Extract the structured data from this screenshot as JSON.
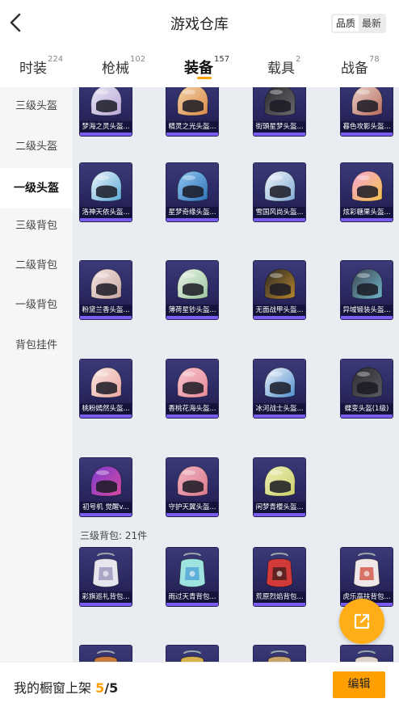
{
  "header": {
    "title": "游戏仓库",
    "sort_options": [
      "品质",
      "最新"
    ],
    "active_sort": "品质"
  },
  "tabs": [
    {
      "label": "时装",
      "count": "224"
    },
    {
      "label": "枪械",
      "count": "102"
    },
    {
      "label": "装备",
      "count": "157"
    },
    {
      "label": "载具",
      "count": "2"
    },
    {
      "label": "战备",
      "count": "78"
    }
  ],
  "active_tab": "装备",
  "sidebar": {
    "items": [
      {
        "label": "三级头盔"
      },
      {
        "label": "二级头盔"
      },
      {
        "label": "一级头盔"
      },
      {
        "label": "三级背包"
      },
      {
        "label": "二级背包"
      },
      {
        "label": "一级背包"
      },
      {
        "label": "背包挂件"
      }
    ],
    "active": "一级头盔"
  },
  "items": [
    {
      "name": "梦海之灵头盔...",
      "kind": "helmet",
      "colors": [
        "#e8e4f2",
        "#b9a9d9"
      ]
    },
    {
      "name": "精灵之光头盔...",
      "kind": "helmet",
      "colors": [
        "#f2d3a8",
        "#d98a4a"
      ]
    },
    {
      "name": "街頭星梦头盔...",
      "kind": "helmet",
      "colors": [
        "#2a2a2e",
        "#6a6a70"
      ]
    },
    {
      "name": "暮色攻影头盔...",
      "kind": "helmet",
      "colors": [
        "#e9d3cc",
        "#b86a5a"
      ]
    },
    {
      "name": "洛神天依头盔...",
      "kind": "helmet",
      "colors": [
        "#eef4fb",
        "#5aa9d6"
      ]
    },
    {
      "name": "星梦奇缘头盔...",
      "kind": "helmet",
      "colors": [
        "#8fc8f0",
        "#2f6fb8"
      ]
    },
    {
      "name": "雪国风尚头盔...",
      "kind": "helmet",
      "colors": [
        "#f2f6fa",
        "#7fa9d6"
      ]
    },
    {
      "name": "炫彩糖果头盔...",
      "kind": "helmet",
      "colors": [
        "#f7a6d6",
        "#f3c14a"
      ]
    },
    {
      "name": "粉黛兰香头盔...",
      "kind": "helmet",
      "colors": [
        "#f3e3e0",
        "#c9a7a2"
      ]
    },
    {
      "name": "薄荷星钞头盔...",
      "kind": "helmet",
      "colors": [
        "#e8f3e6",
        "#9cc7a0"
      ]
    },
    {
      "name": "无面战甲头盔...",
      "kind": "helmet",
      "colors": [
        "#2a2824",
        "#b8862e"
      ]
    },
    {
      "name": "异域锻装头盔...",
      "kind": "helmet",
      "colors": [
        "#3d4450",
        "#6fb6c9"
      ]
    },
    {
      "name": "桃粉嫣然头盔...",
      "kind": "helmet",
      "colors": [
        "#fbe7e2",
        "#e9a7a0"
      ]
    },
    {
      "name": "香桃花海头盔...",
      "kind": "helmet",
      "colors": [
        "#f6c4cc",
        "#e88a9a"
      ]
    },
    {
      "name": "冰河战士头盔...",
      "kind": "helmet",
      "colors": [
        "#eef3f8",
        "#4f8fd0"
      ]
    },
    {
      "name": "蝶变头盔(1级)",
      "kind": "helmet",
      "colors": [
        "#2c2c30",
        "#5a5a62"
      ]
    },
    {
      "name": "初号机 觉醒v...",
      "kind": "helmet",
      "colors": [
        "#7a3bd0",
        "#d64aa0"
      ]
    },
    {
      "name": "守护天翼头盔...",
      "kind": "helmet",
      "colors": [
        "#f2b3c0",
        "#d97a8e"
      ]
    },
    {
      "name": "闲梦青樱头盔...",
      "kind": "helmet",
      "colors": [
        "#eef0b8",
        "#c9cf6a"
      ]
    },
    {
      "name": "彩旗巡礼背包...",
      "kind": "backpack",
      "colors": [
        "#e6e6ef",
        "#9a8fb8"
      ]
    },
    {
      "name": "雨过天青背包...",
      "kind": "backpack",
      "colors": [
        "#9ee3e0",
        "#4a9fd6"
      ]
    },
    {
      "name": "荒原烈焰背包...",
      "kind": "backpack",
      "colors": [
        "#d23a3a",
        "#3a1a1a"
      ]
    },
    {
      "name": "虎乐高扶背包...",
      "kind": "backpack",
      "colors": [
        "#f0e8e8",
        "#d04a3a"
      ]
    },
    {
      "name": "",
      "kind": "backpack",
      "colors": [
        "#c97a3a",
        "#3a2a1a"
      ]
    },
    {
      "name": "",
      "kind": "backpack",
      "colors": [
        "#d6b04a",
        "#3a2f1a"
      ]
    },
    {
      "name": "",
      "kind": "backpack",
      "colors": [
        "#c9a36a",
        "#2a2218"
      ]
    },
    {
      "name": "",
      "kind": "backpack",
      "colors": [
        "#e0d2c8",
        "#b8a8a0"
      ]
    }
  ],
  "section": {
    "label": "三级背包: 21件"
  },
  "bottom_bar": {
    "label": "我的橱窗上架",
    "current": "5",
    "separator": "/",
    "max": "5",
    "edit_label": "编辑"
  },
  "icons": {
    "back": "chevron-left-icon",
    "share": "share-external-icon"
  },
  "colors": {
    "accent": "#ffa000",
    "card_bg": "#2b2961",
    "card_stripe": "#7a5cf0",
    "content_bg": "#e9ecf0"
  }
}
